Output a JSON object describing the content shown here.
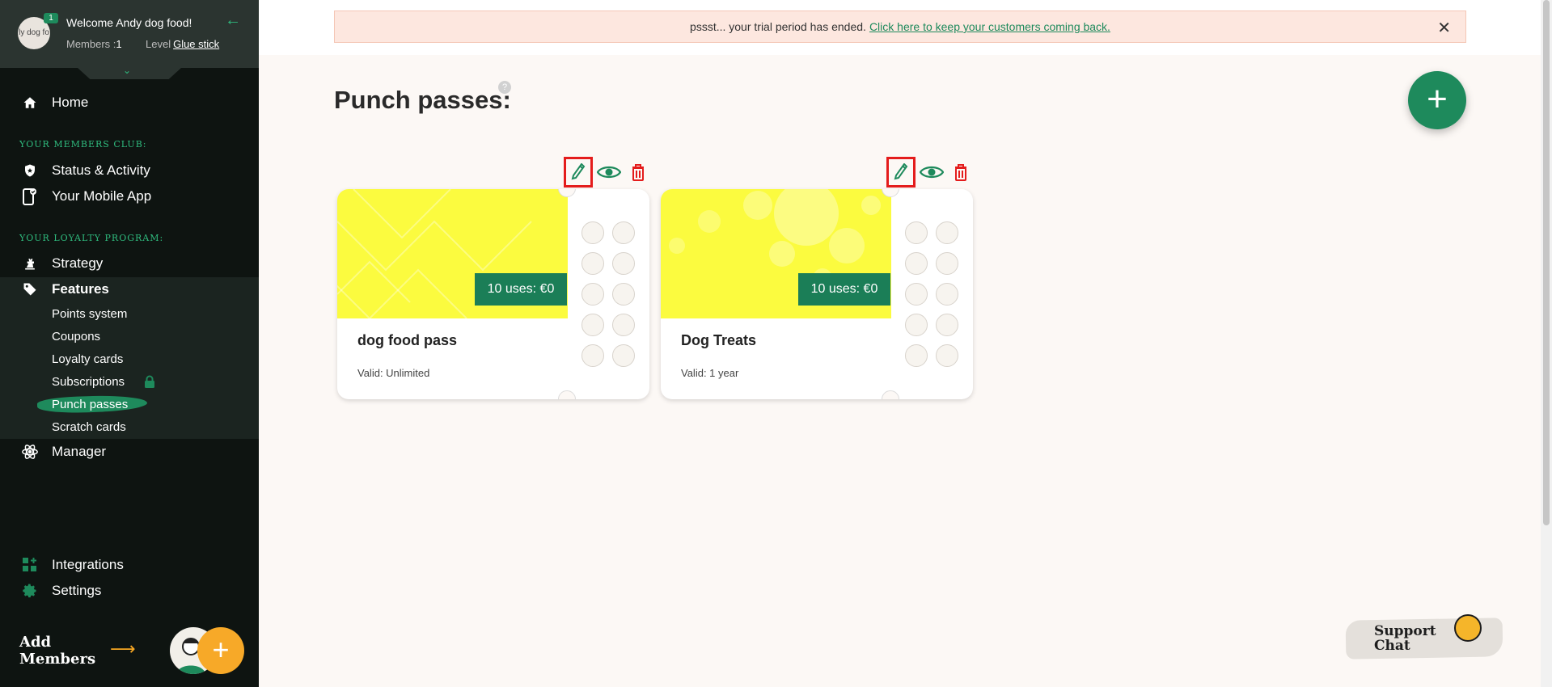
{
  "sidebar": {
    "avatar_text": "ly dog fo",
    "avatar_badge": "1",
    "welcome": "Welcome Andy dog food!",
    "members_label": "Members :",
    "members_count": "1",
    "level_label": "Level",
    "level_value": "Glue stick",
    "home": "Home",
    "section_members_club": "YOUR MEMBERS CLUB:",
    "status_activity": "Status & Activity",
    "mobile_app": "Your Mobile App",
    "section_loyalty": "YOUR LOYALTY PROGRAM:",
    "strategy": "Strategy",
    "features": "Features",
    "sub_items": {
      "points": "Points system",
      "coupons": "Coupons",
      "loyalty_cards": "Loyalty cards",
      "subscriptions": "Subscriptions",
      "punch_passes": "Punch passes",
      "scratch_cards": "Scratch cards"
    },
    "manager": "Manager",
    "integrations": "Integrations",
    "settings": "Settings",
    "add_members_line1": "Add",
    "add_members_line2": "Members"
  },
  "banner": {
    "text": "pssst... your trial period has ended.",
    "link": "Click here to keep your customers coming back."
  },
  "page": {
    "title": "Punch passes:",
    "help": "?"
  },
  "cards": [
    {
      "price": "10 uses: €0",
      "title": "dog food pass",
      "valid": "Valid: Unlimited"
    },
    {
      "price": "10 uses: €0",
      "title": "Dog Treats",
      "valid": "Valid: 1 year"
    }
  ],
  "support": {
    "line1": "Support",
    "line2": "Chat"
  },
  "colors": {
    "brand_green": "#1e8a5c",
    "sidebar_bg": "#0e1411",
    "card_yellow": "#fbfb3f",
    "alert_red": "#e41c1c",
    "accent_orange": "#f7a928"
  }
}
